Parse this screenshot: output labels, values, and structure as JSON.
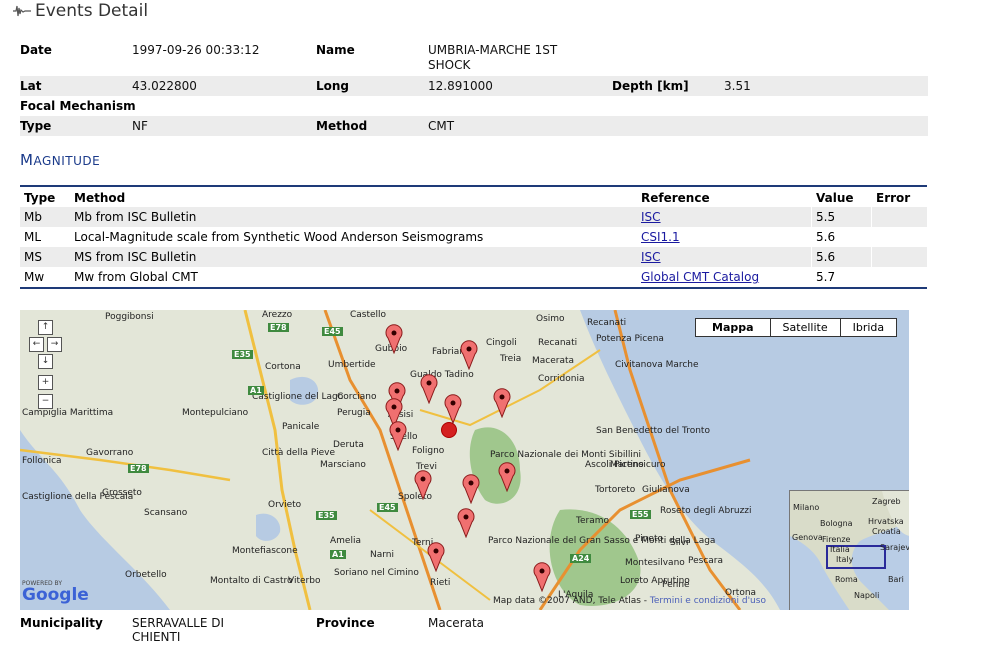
{
  "header": {
    "title": "Events Detail",
    "icon": "seismogram-icon"
  },
  "event": {
    "date_label": "Date",
    "date": "1997-09-26 00:33:12",
    "name_label": "Name",
    "name_line1": "UMBRIA-MARCHE 1ST",
    "name_line2": "SHOCK",
    "lat_label": "Lat",
    "lat": "43.022800",
    "long_label": "Long",
    "long": "12.891000",
    "depth_label": "Depth [km]",
    "depth": "3.51",
    "focal_label": "Focal Mechanism",
    "type_label": "Type",
    "type": "NF",
    "method_label": "Method",
    "method": "CMT"
  },
  "magnitude": {
    "title_first": "M",
    "title_rest": "AGNITUDE",
    "columns": [
      "Type",
      "Method",
      "Reference",
      "Value",
      "Error"
    ],
    "rows": [
      {
        "type": "Mb",
        "method": "Mb from ISC Bulletin",
        "reference": "ISC",
        "value": "5.5",
        "error": ""
      },
      {
        "type": "ML",
        "method": "Local-Magnitude scale from Synthetic Wood Anderson Seismograms",
        "reference": "CSI1.1",
        "value": "5.6",
        "error": ""
      },
      {
        "type": "MS",
        "method": "MS from ISC Bulletin",
        "reference": "ISC",
        "value": "5.6",
        "error": ""
      },
      {
        "type": "Mw",
        "method": "Mw from Global CMT",
        "reference": "Global CMT Catalog",
        "value": "5.7",
        "error": ""
      }
    ]
  },
  "map": {
    "map_types": [
      "Mappa",
      "Satellite",
      "Ibrida"
    ],
    "selected_type": "Mappa",
    "places": [
      "Poggibonsi",
      "Arezzo",
      "Castello",
      "Osimo",
      "Recanati",
      "Gubbio",
      "Fabriano",
      "Cingoli",
      "Recanati",
      "Potenza Picena",
      "Umbertide",
      "Macerata",
      "Civitanova Marche",
      "Cortona",
      "Gualdo Tadino",
      "Treia",
      "Corridonia",
      "Montepulciano",
      "Castiglione del Lago",
      "Corciano",
      "Perugia",
      "Assisi",
      "Spello",
      "Panicale",
      "San Benedetto del Tronto",
      "Deruta",
      "Foligno",
      "Città della Pieve",
      "Marsciano",
      "Trevi",
      "Parco Nazionale dei Monti Sibillini",
      "Ascoli Piceno",
      "Martinsicuro",
      "Grosseto",
      "Spoleto",
      "Tortoreto",
      "Giulianova",
      "Orvieto",
      "Teramo",
      "Roseto degli Abruzzi",
      "Scansano",
      "Amelia",
      "Parco Nazionale del Gran Sasso e Monti della Laga",
      "Pineto",
      "Montefiascone",
      "Terni",
      "Silvi",
      "Narni",
      "Orbetello",
      "Montesilvano",
      "Pescara",
      "Montalto di Castro",
      "Viterbo",
      "Soriano nel Cimino",
      "Rieti",
      "L'Aquila",
      "Loreto Aprutino",
      "Penne",
      "Ortona",
      "Follonica",
      "Castiglione della Pescaia",
      "Gavorrano",
      "Campiglia Marittima"
    ],
    "roads": [
      "E78",
      "E45",
      "E35",
      "A1",
      "E78",
      "E35",
      "E45",
      "E55",
      "A24",
      "A1"
    ],
    "attribution": "Map data ©2007 AND, Tele Atlas",
    "tos": "Termini e condizioni d'uso",
    "powered_by": "POWERED BY",
    "logo": "Google",
    "overview_places": [
      "Milano",
      "Zagreb",
      "Hrvatska",
      "Croatia",
      "Bologna",
      "Firenze",
      "Sarajevo",
      "Genova",
      "Italia",
      "Italy",
      "Roma",
      "Bari",
      "Napoli"
    ],
    "nav_icons": [
      "pan-up-icon",
      "pan-left-icon",
      "pan-right-icon",
      "pan-down-icon",
      "zoom-in-icon",
      "zoom-out-icon"
    ],
    "marker_icon": "map-marker-icon",
    "epicenter_color": "#d42020"
  },
  "location": {
    "municipality_label": "Municipality",
    "municipality_line1": "SERRAVALLE DI",
    "municipality_line2": "CHIENTI",
    "province_label": "Province",
    "province": "Macerata"
  },
  "colors": {
    "accent": "#1e3a78",
    "link": "#1a1aa0",
    "row_shade": "#ececec"
  }
}
